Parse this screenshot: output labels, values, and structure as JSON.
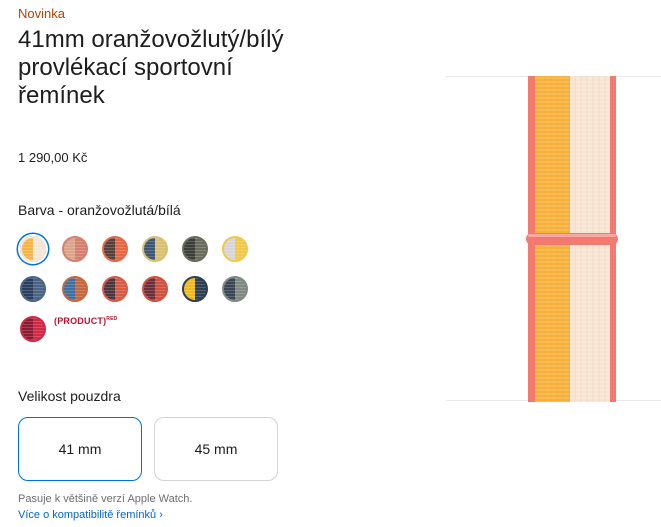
{
  "product": {
    "eyebrow": "Novinka",
    "title": "41mm oranžovožlutý/bílý provlékací sportovní řemínek",
    "price": "1 290,00 Kč"
  },
  "color": {
    "label": "Barva - oranžovožlutá/bílá",
    "product_red": "(PRODUCT)",
    "product_red_sup": "RED",
    "swatch_colors": [
      [
        "#f6b447",
        "#f4e5d6"
      ],
      [
        "#d9a58b",
        "#d67f70"
      ],
      [
        "#563f3c",
        "#e56746"
      ],
      [
        "#3d5674",
        "#d8c070"
      ],
      [
        "#3c3f35",
        "#6a6d5e"
      ],
      [
        "#d8d6d9",
        "#f0c84a"
      ],
      [
        "#2a3f60",
        "#4a6584"
      ],
      [
        "#3f6f9f",
        "#c6673e"
      ],
      [
        "#4a3540",
        "#d65a44"
      ],
      [
        "#6c2f3a",
        "#d0513f"
      ],
      [
        "#f0b920",
        "#2f3f52"
      ],
      [
        "#3a4556",
        "#7e8a82"
      ],
      [
        "#8a1c32",
        "#d02845"
      ]
    ]
  },
  "size": {
    "label": "Velikost pouzdra",
    "options": [
      "41 mm",
      "45 mm"
    ],
    "selected": "41 mm"
  },
  "compat": {
    "text": "Pasuje k většině verzí Apple Watch.",
    "link": "Více o kompatibilitě řemínků ›"
  },
  "image_colors": {
    "orange": "#f7b13b",
    "cream": "#f7e4d2",
    "edge": "#f47a70",
    "accent": "#0071e3"
  }
}
